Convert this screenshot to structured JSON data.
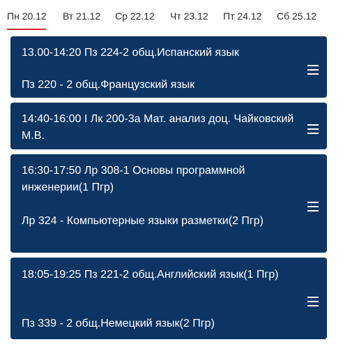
{
  "tabs": [
    {
      "label": "Пн 20.12",
      "selected": true
    },
    {
      "label": "Вт 21.12",
      "selected": false
    },
    {
      "label": "Ср 22.12",
      "selected": false
    },
    {
      "label": "Чт 23.12",
      "selected": false
    },
    {
      "label": "Пт 24.12",
      "selected": false
    },
    {
      "label": "Сб 25.12",
      "selected": false
    }
  ],
  "colors": {
    "card_background": "#0d3563",
    "card_text": "#ffffff",
    "tab_underline": "#d9232e"
  },
  "lessons": [
    {
      "line1": "13.00-14:20 Пз 224-2 общ.Испанский язык",
      "line2": "Пз 220 - 2 общ.Французский язык"
    },
    {
      "line1": "14:40-16:00 I Лк 200-3а Мат. анализ доц. Чайковский М.В."
    },
    {
      "line1": "16:30-17:50 Лр 308-1 Основы программной инженерии(1 Пгр)",
      "line2": "Лр 324 - Компьютерные языки разметки(2 Пгр)"
    },
    {
      "line1": "18:05-19:25 Пз 221-2 общ.Английский язык(1 Пгр)",
      "line2": "Пз 339 - 2 общ.Немецкий язык(2 Пгр)"
    }
  ]
}
